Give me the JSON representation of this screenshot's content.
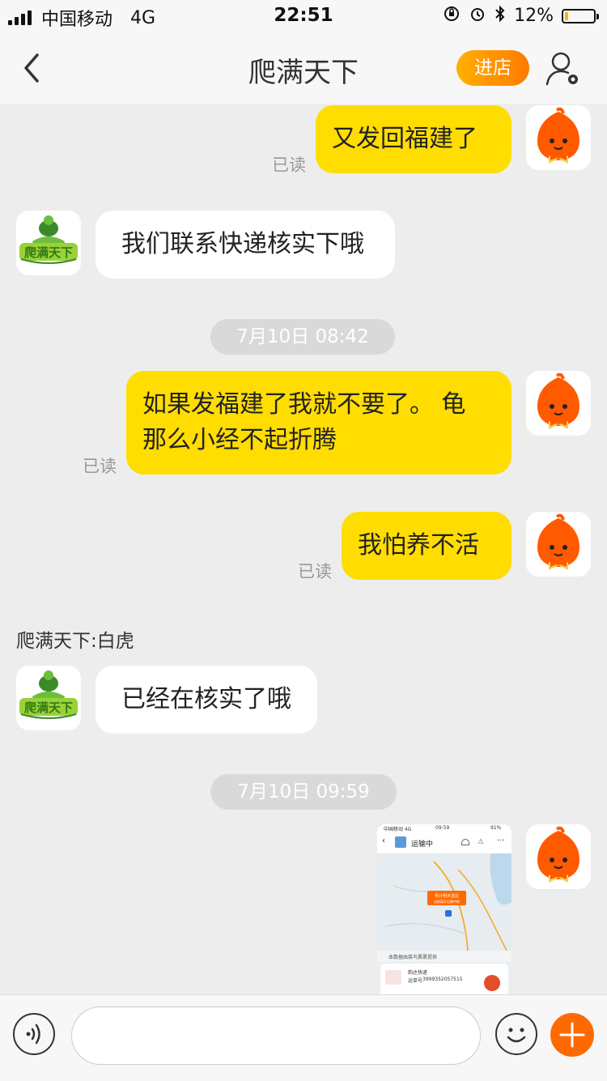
{
  "status_bar": {
    "carrier": "中国移动",
    "network": "4G",
    "time": "22:51",
    "battery_percent_text": "12%",
    "battery_level": 0.12,
    "battery_color": "#f2b600"
  },
  "nav": {
    "title": "爬满天下",
    "enter_store_label": "进店",
    "back_icon": "chevron-left-icon",
    "profile_icon": "user-settings-icon"
  },
  "messages": {
    "m1": "又发回福建了",
    "m1_read": "已读",
    "m2": "我们联系快递核实下哦",
    "ts1": "7月10日 08:42",
    "m3_line1": "如果发福建了我就不要了。 龟",
    "m3_line2": "那么小经不起折腾",
    "m3_read": "已读",
    "m4": "我怕养不活",
    "m4_read": "已读",
    "sender_label": "爬满天下:白虎",
    "m5": "已经在核实了哦",
    "ts2": "7月10日 09:59"
  },
  "shop_logo_text": "爬满天下",
  "thumbnail": {
    "status_carrier": "中国移动 4G",
    "status_time": "09:59",
    "status_battery": "91%",
    "header_title": "运输中",
    "map_badge_line1": "预计明天送达",
    "map_badge_line2": "当前离开石狮中转",
    "source_note": "本数据由菜鸟裹裹提供",
    "courier_name": "韵达快递",
    "tracking_label": "运单号",
    "tracking_number": "3999352057515"
  },
  "input_bar": {
    "voice_icon": "voice-icon",
    "emoji_icon": "emoji-icon",
    "plus_icon": "plus-icon"
  },
  "colors": {
    "my_bubble": "#ffdd00",
    "accent_orange": "#ff6a00"
  }
}
